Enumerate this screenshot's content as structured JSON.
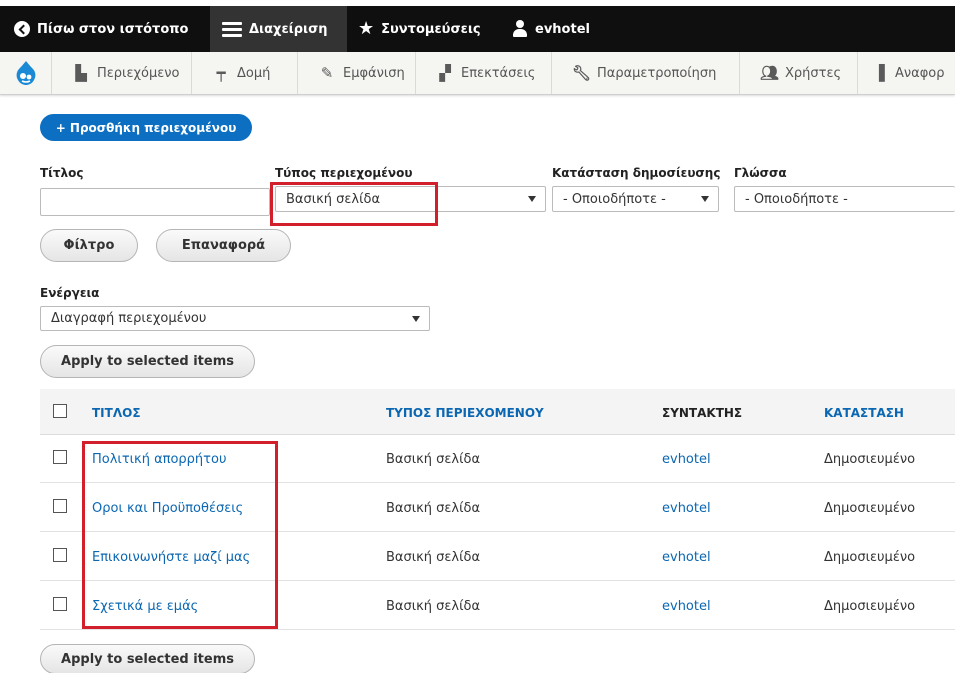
{
  "toolbar": {
    "back_label": "Πίσω στον ιστότοπο",
    "manage_label": "Διαχείριση",
    "shortcuts_label": "Συντομεύσεις",
    "user_label": "evhotel"
  },
  "admin_menu": {
    "items": [
      {
        "label": "Περιεχόμενο",
        "icon": "document-icon"
      },
      {
        "label": "Δομή",
        "icon": "structure-icon"
      },
      {
        "label": "Εμφάνιση",
        "icon": "appearance-icon"
      },
      {
        "label": "Επεκτάσεις",
        "icon": "extend-icon"
      },
      {
        "label": "Παραμετροποίηση",
        "icon": "wrench-icon"
      },
      {
        "label": "Χρήστες",
        "icon": "people-icon"
      },
      {
        "label": "Αναφορ",
        "icon": "reports-icon"
      }
    ]
  },
  "add_content_label": "+ Προσθήκη περιεχομένου",
  "filters": {
    "title_label": "Τίτλος",
    "title_value": "",
    "type_label": "Τύπος περιεχομένου",
    "type_value": "Βασική σελίδα",
    "status_label": "Κατάσταση δημοσίευσης",
    "status_value": "- Οποιοδήποτε -",
    "language_label": "Γλώσσα",
    "language_value": "- Οποιοδήποτε -",
    "filter_button": "Φίλτρο",
    "reset_button": "Επαναφορά"
  },
  "action": {
    "label": "Ενέργεια",
    "value": "Διαγραφή περιεχομένου",
    "apply_button": "Apply to selected items"
  },
  "table": {
    "columns": [
      "ΤΙΤΛΟΣ",
      "ΤΥΠΟΣ ΠΕΡΙΕΧΟΜΕΝΟΥ",
      "ΣΥΝΤΑΚΤΗΣ",
      "ΚΑΤΑΣΤΑΣΗ"
    ],
    "rows": [
      {
        "title": "Πολιτική απορρήτου",
        "type": "Βασική σελίδα",
        "author": "evhotel",
        "status": "Δημοσιευμένο"
      },
      {
        "title": "Οροι και Προϋποθέσεις",
        "type": "Βασική σελίδα",
        "author": "evhotel",
        "status": "Δημοσιευμένο"
      },
      {
        "title": "Επικοινωνήστε μαζί μας",
        "type": "Βασική σελίδα",
        "author": "evhotel",
        "status": "Δημοσιευμένο"
      },
      {
        "title": "Σχετικά με εμάς",
        "type": "Βασική σελίδα",
        "author": "evhotel",
        "status": "Δημοσιευμένο"
      }
    ]
  },
  "colors": {
    "primary_button": "#0d6fc2",
    "link": "#0b67b2",
    "highlight": "#d21f2b",
    "toolbar": "#0f0f0f"
  }
}
